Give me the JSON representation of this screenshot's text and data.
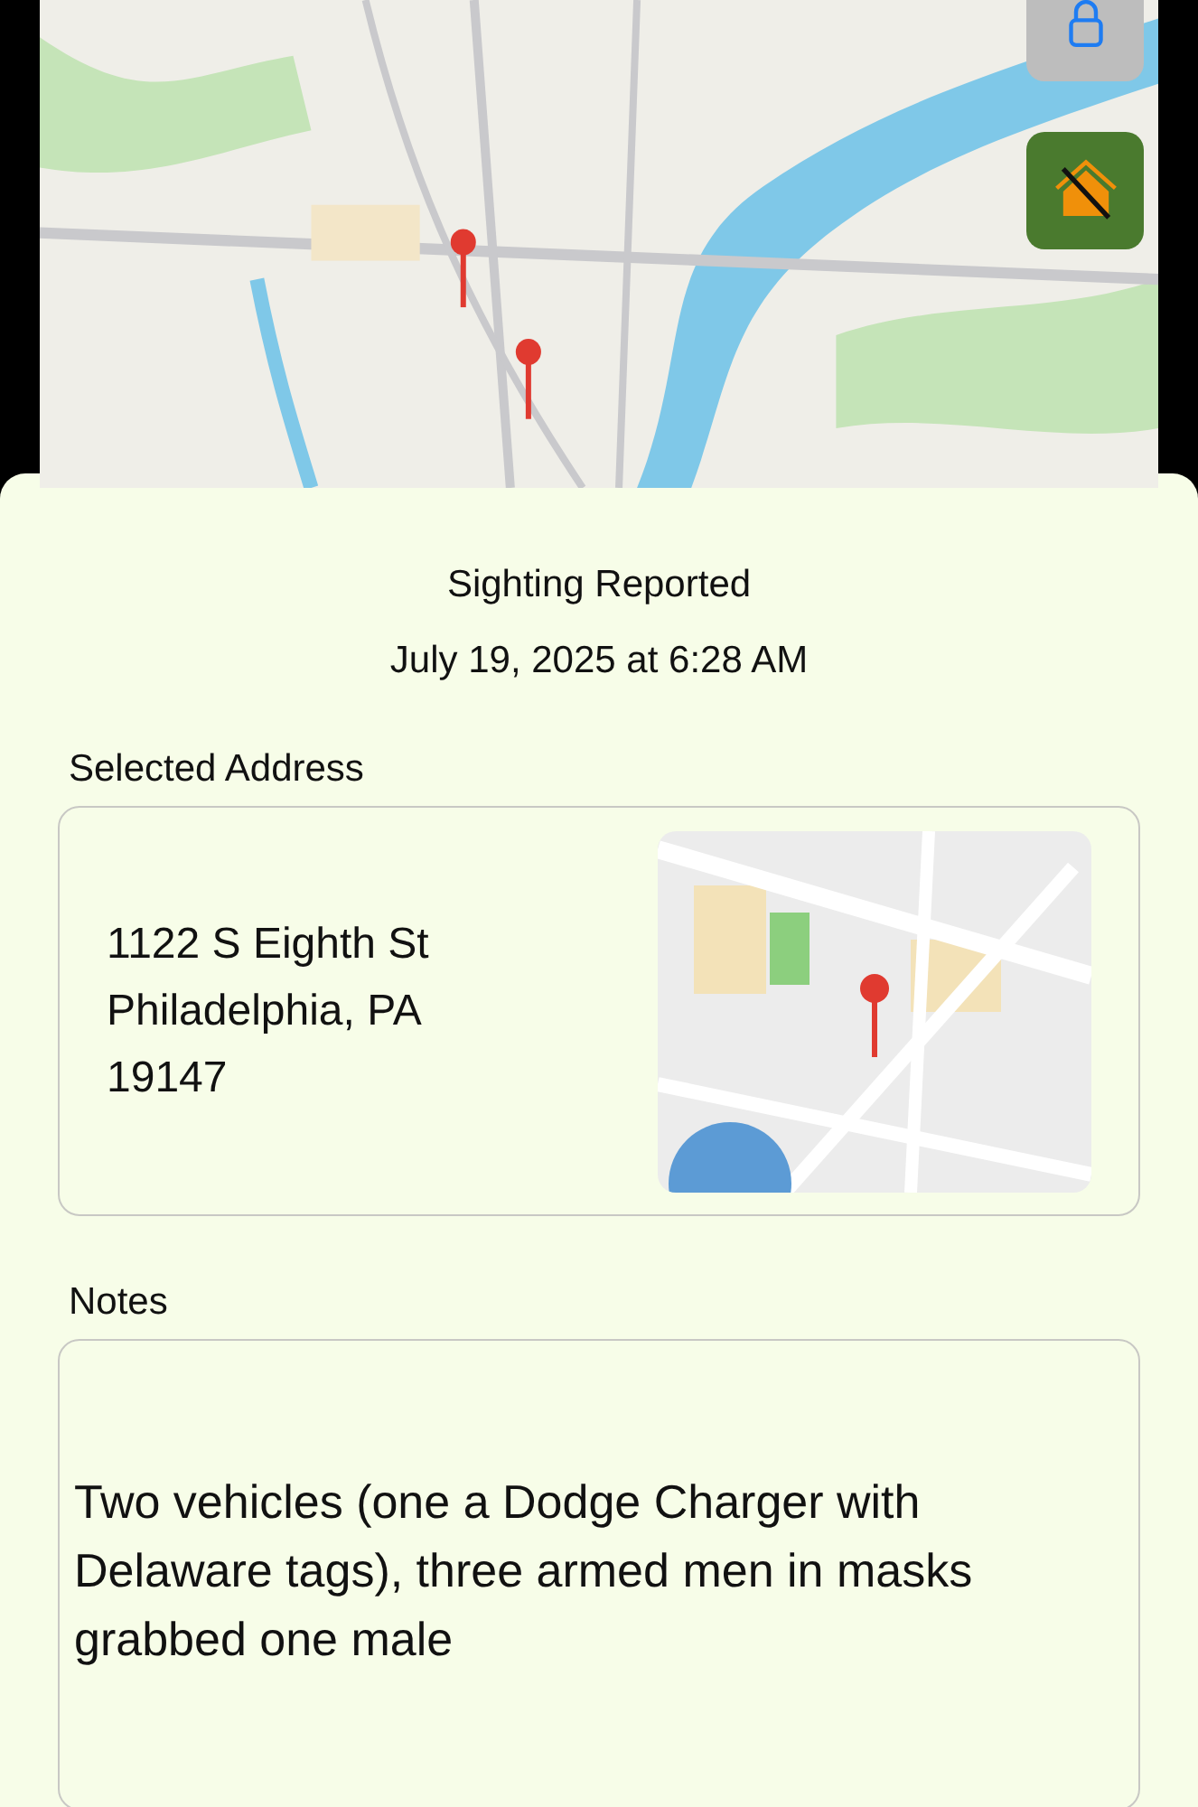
{
  "map_buttons": [
    {
      "kind": "lock"
    },
    {
      "kind": "home-off"
    }
  ],
  "header": {
    "title": "Sighting Reported",
    "timestamp": "July 19, 2025 at 6:28 AM"
  },
  "address_section": {
    "label": "Selected Address",
    "lines": [
      "1122 S Eighth St",
      "Philadelphia, PA",
      "19147"
    ]
  },
  "notes_section": {
    "label": "Notes",
    "value": "Two vehicles (one a Dodge Charger with Delaware tags), three armed men in masks grabbed one male"
  }
}
